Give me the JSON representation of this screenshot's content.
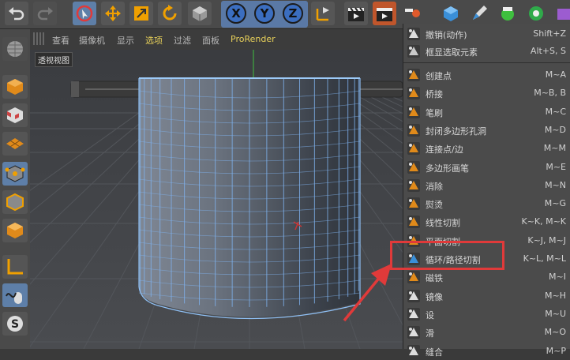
{
  "viewport_menu": {
    "items": [
      "查看",
      "摄像机",
      "显示",
      "选项",
      "过滤",
      "面板",
      "ProRender"
    ],
    "highlighted": [
      3,
      6
    ]
  },
  "viewport_label": "透视视图",
  "axis_buttons": [
    "X",
    "Y",
    "Z"
  ],
  "context_menu": {
    "groups": [
      [
        {
          "label": "撤销(动作)",
          "shortcut": "Shift+Z",
          "icon": "undo-action-icon"
        },
        {
          "label": "框显选取元素",
          "shortcut": "Alt+S, S",
          "icon": "frame-selected-icon"
        }
      ],
      [
        {
          "label": "创建点",
          "shortcut": "M~A",
          "icon": "create-point-icon"
        },
        {
          "label": "桥接",
          "shortcut": "M~B, B",
          "icon": "bridge-icon"
        },
        {
          "label": "笔刷",
          "shortcut": "M~C",
          "icon": "brush-icon"
        },
        {
          "label": "封闭多边形孔洞",
          "shortcut": "M~D",
          "icon": "close-polygon-hole-icon"
        },
        {
          "label": "连接点/边",
          "shortcut": "M~M",
          "icon": "connect-points-edges-icon"
        },
        {
          "label": "多边形画笔",
          "shortcut": "M~E",
          "icon": "polygon-pen-icon"
        },
        {
          "label": "消除",
          "shortcut": "M~N",
          "icon": "dissolve-icon"
        },
        {
          "label": "熨烫",
          "shortcut": "M~G",
          "icon": "iron-icon"
        },
        {
          "label": "线性切割",
          "shortcut": "K~K, M~K",
          "icon": "line-cut-icon"
        },
        {
          "label": "平面切割",
          "shortcut": "K~J, M~J",
          "icon": "plane-cut-icon"
        },
        {
          "label": "循环/路径切割",
          "shortcut": "K~L, M~L",
          "icon": "loop-path-cut-icon"
        },
        {
          "label": "磁铁",
          "shortcut": "M~I",
          "icon": "magnet-icon"
        },
        {
          "label": "镜像",
          "shortcut": "M~H",
          "icon": "mirror-icon"
        },
        {
          "label": "设",
          "shortcut": "M~U",
          "icon": "set-point-value-icon"
        },
        {
          "label": "滑",
          "shortcut": "M~O",
          "icon": "slide-icon"
        },
        {
          "label": "缝合",
          "shortcut": "M~P",
          "icon": "stitch-icon"
        }
      ]
    ]
  },
  "annotation": {
    "color": "#e03a3a",
    "target": "循环/路径切割"
  },
  "colors": {
    "accent": "#5e7fa8",
    "mesh_edge": "#7fb2ee",
    "highlight_text": "#e8d15a"
  }
}
